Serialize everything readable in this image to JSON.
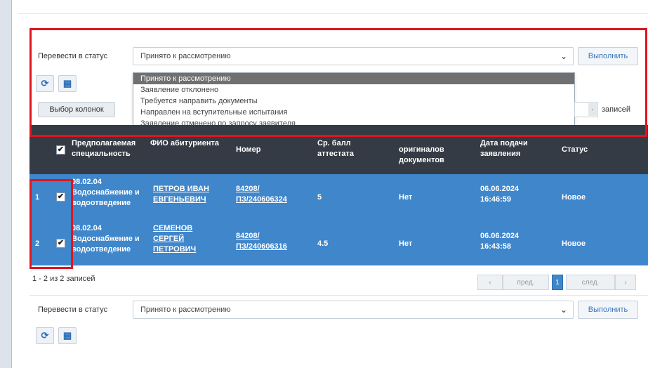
{
  "status_bar_top": {
    "label": "Перевести в статус",
    "selected": "Принято к рассмотрению",
    "execute_label": "Выполнить"
  },
  "dropdown_options": [
    "Принято к рассмотрению",
    "Заявление отклонено",
    "Требуется направить документы",
    "Направлен на вступительные испытания",
    "Заявление отменено по запросу заявителя"
  ],
  "toolbar": {
    "refresh_icon": "refresh-icon",
    "grid_icon": "grid-icon",
    "columns_button": "Выбор колонок",
    "records_label": "записей"
  },
  "table": {
    "headers": {
      "specialty": "Предполагаемая специальность",
      "fio": "ФИО абитуриента",
      "number": "Номер",
      "score": "Ср. балл аттестата",
      "originals": "оригиналов документов",
      "date": "Дата подачи заявления",
      "status": "Статус"
    },
    "rows": [
      {
        "index": "1",
        "specialty": "08.02.04 Водоснабжение и водоотведение",
        "fio": "ПЕТРОВ ИВАН ЕВГЕНЬЕВИЧ",
        "number": "84208/ ПЗ/240606324",
        "score": "5",
        "originals": "Нет",
        "date": "06.06.2024 16:46:59",
        "status": "Новое"
      },
      {
        "index": "2",
        "specialty": "08.02.04 Водоснабжение и водоотведение",
        "fio": "СЕМЕНОВ СЕРГЕЙ ПЕТРОВИЧ",
        "number": "84208/ ПЗ/240606316",
        "score": "4.5",
        "originals": "Нет",
        "date": "06.06.2024 16:43:58",
        "status": "Новое"
      }
    ]
  },
  "footer": {
    "count": "1 - 2 из 2 записей",
    "prev": "пред.",
    "page": "1",
    "next": "след."
  },
  "status_bar_bottom": {
    "label": "Перевести в статус",
    "selected": "Принято к рассмотрению",
    "execute_label": "Выполнить"
  },
  "colors": {
    "header_bg": "#353b44",
    "row_bg": "#3f86cb",
    "highlight": "#e0141e"
  }
}
